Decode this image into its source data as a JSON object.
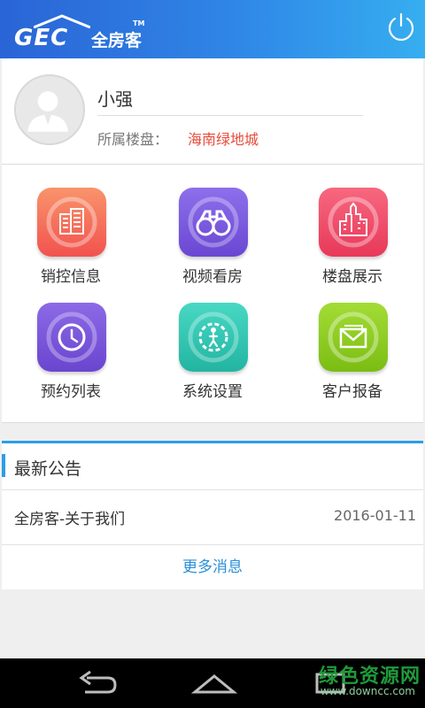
{
  "header": {
    "logo_mark": "GEC",
    "logo_name": "全房客",
    "logo_tm": "TM",
    "power_icon": "power-icon"
  },
  "profile": {
    "username": "小强",
    "estate_label": "所属楼盘：",
    "estate_value": "海南绿地城"
  },
  "menu": [
    {
      "label": "销控信息",
      "icon": "buildings-icon",
      "color": "#f26a55"
    },
    {
      "label": "视频看房",
      "icon": "binoculars-icon",
      "color": "#7b5ce0"
    },
    {
      "label": "楼盘展示",
      "icon": "skyline-icon",
      "color": "#ef4a64"
    },
    {
      "label": "预约列表",
      "icon": "clock-icon",
      "color": "#7a5ad9"
    },
    {
      "label": "系统设置",
      "icon": "gear-person-icon",
      "color": "#2ec7b4"
    },
    {
      "label": "客户报备",
      "icon": "envelope-icon",
      "color": "#8ccc22"
    }
  ],
  "notice": {
    "title": "最新公告",
    "items": [
      {
        "title": "全房客-关于我们",
        "date": "2016-01-11"
      }
    ],
    "more_label": "更多消息"
  },
  "watermark": {
    "name": "绿色资源网",
    "url": "www.downcc.com"
  },
  "navbar": {
    "back_icon": "back-icon",
    "home_icon": "home-icon",
    "recent_icon": "recent-apps-icon"
  }
}
